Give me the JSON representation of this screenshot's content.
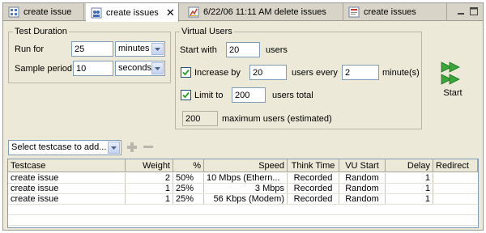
{
  "tabs": [
    {
      "label": "create issue",
      "active": false
    },
    {
      "label": "create issues",
      "active": true
    },
    {
      "label": "6/22/06 11:11 AM delete issues",
      "active": false
    },
    {
      "label": "create issues",
      "active": false
    }
  ],
  "test_duration": {
    "title": "Test Duration",
    "run_for_label": "Run for",
    "run_for_value": "25",
    "run_for_unit": "minutes",
    "sample_period_label": "Sample period",
    "sample_period_value": "10",
    "sample_period_unit": "seconds"
  },
  "virtual_users": {
    "title": "Virtual Users",
    "start_with_label": "Start with",
    "start_with_value": "20",
    "users_label": "users",
    "increase_by_label": "Increase by",
    "increase_by_checked": true,
    "increase_by_value": "20",
    "users_every_label": "users every",
    "users_every_value": "2",
    "minutes_label": "minute(s)",
    "limit_to_label": "Limit to",
    "limit_to_checked": true,
    "limit_to_value": "200",
    "users_total_label": "users total",
    "max_users_value": "200",
    "max_users_label": "maximum users (estimated)"
  },
  "start_button": {
    "label": "Start"
  },
  "testcase_select": {
    "value": "Select testcase to add..."
  },
  "table": {
    "columns": [
      "Testcase",
      "Weight",
      "%",
      "Speed",
      "Think Time",
      "VU Start",
      "Delay",
      "Redirect"
    ],
    "rows": [
      [
        "create issue",
        "2",
        "50%",
        "10 Mbps (Ethern...",
        "Recorded",
        "Random",
        "1",
        ""
      ],
      [
        "create issue",
        "1",
        "25%",
        "3 Mbps",
        "Recorded",
        "Random",
        "1",
        ""
      ],
      [
        "create issue",
        "1",
        "25%",
        "56 Kbps (Modem)",
        "Recorded",
        "Random",
        "1",
        ""
      ]
    ]
  },
  "colors": {
    "panel_bg": "#ece9d8",
    "start_icon_green": "#3aa63a",
    "active_tab_bg": "#ffffff"
  },
  "icons": [
    "testcase-tab-icon",
    "loadtest-tab-icon",
    "report-tab-icon",
    "close-icon",
    "minimize-icon",
    "maximize-icon",
    "start-run-icon",
    "add-icon",
    "remove-icon",
    "dropdown-arrow-icon",
    "checkbox-check-icon"
  ]
}
